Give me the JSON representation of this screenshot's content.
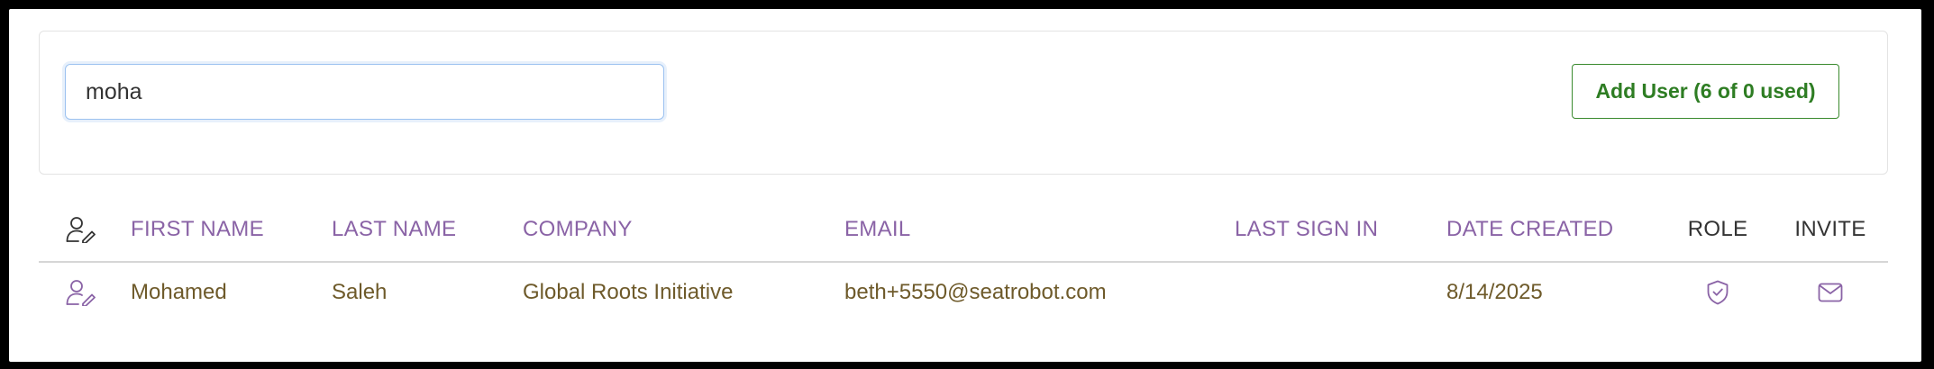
{
  "search": {
    "value": "moha",
    "placeholder": ""
  },
  "toolbar": {
    "add_user_label": "Add User (6 of 0 used)"
  },
  "table": {
    "columns": {
      "first_name": "FIRST NAME",
      "last_name": "LAST NAME",
      "company": "COMPANY",
      "email": "EMAIL",
      "last_sign_in": "LAST SIGN IN",
      "date_created": "DATE CREATED",
      "role": "ROLE",
      "invite": "INVITE"
    },
    "rows": [
      {
        "first_name": "Mohamed",
        "last_name": "Saleh",
        "company": "Global Roots Initiative",
        "email": "beth+5550@seatrobot.com",
        "last_sign_in": "",
        "date_created": "8/14/2025"
      }
    ]
  },
  "icons": {
    "header": "user-edit-icon",
    "row_edit": "user-edit-icon",
    "role": "shield-check-icon",
    "invite": "envelope-icon"
  },
  "colors": {
    "header_text": "#8a63a6",
    "cell_text": "#6e5a2a",
    "button_green": "#2e7d23",
    "input_focus_border": "#9cc2f0"
  }
}
